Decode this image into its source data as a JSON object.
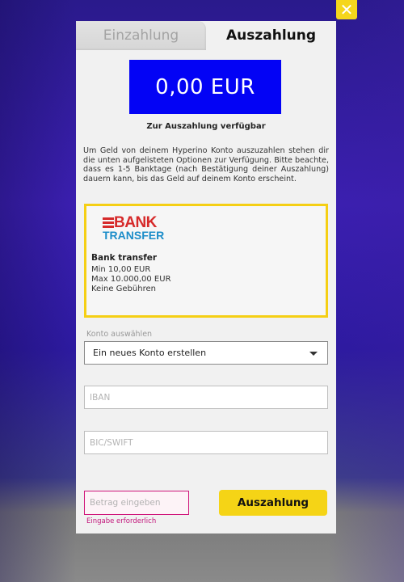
{
  "tabs": [
    {
      "label": "Einzahlung",
      "active": false
    },
    {
      "label": "Auszahlung",
      "active": true
    }
  ],
  "close_icon": "close-icon",
  "balance": {
    "amount": "0,00 EUR",
    "caption": "Zur Auszahlung verfügbar",
    "color": "#0303f5"
  },
  "info_text": "Um Geld von deinem Hyperino Konto auszuzahlen stehen dir die unten aufgelisteten Optionen zur Verfügung. Bitte beachte, dass es 1-5 Banktage (nach Bestätigung deiner Auszahlung) dauern kann, bis das Geld auf deinem Konto erscheint.",
  "method": {
    "logo_word_1": "BANK",
    "logo_word_2": "TRANSFER",
    "name": "Bank transfer",
    "min": "Min 10,00 EUR",
    "max": "Max 10.000,00 EUR",
    "fees": "Keine Gebühren",
    "border_color": "#f5cf14"
  },
  "account": {
    "label": "Konto auswählen",
    "selected": "Ein neues Konto erstellen"
  },
  "iban": {
    "placeholder": "IBAN",
    "value": ""
  },
  "bic": {
    "placeholder": "BIC/SWIFT",
    "value": ""
  },
  "amount": {
    "placeholder": "Betrag eingeben",
    "value": "",
    "error": "Eingabe erforderlich",
    "error_color": "#c2167b"
  },
  "submit": {
    "label": "Auszahlung",
    "color": "#f5d416"
  }
}
